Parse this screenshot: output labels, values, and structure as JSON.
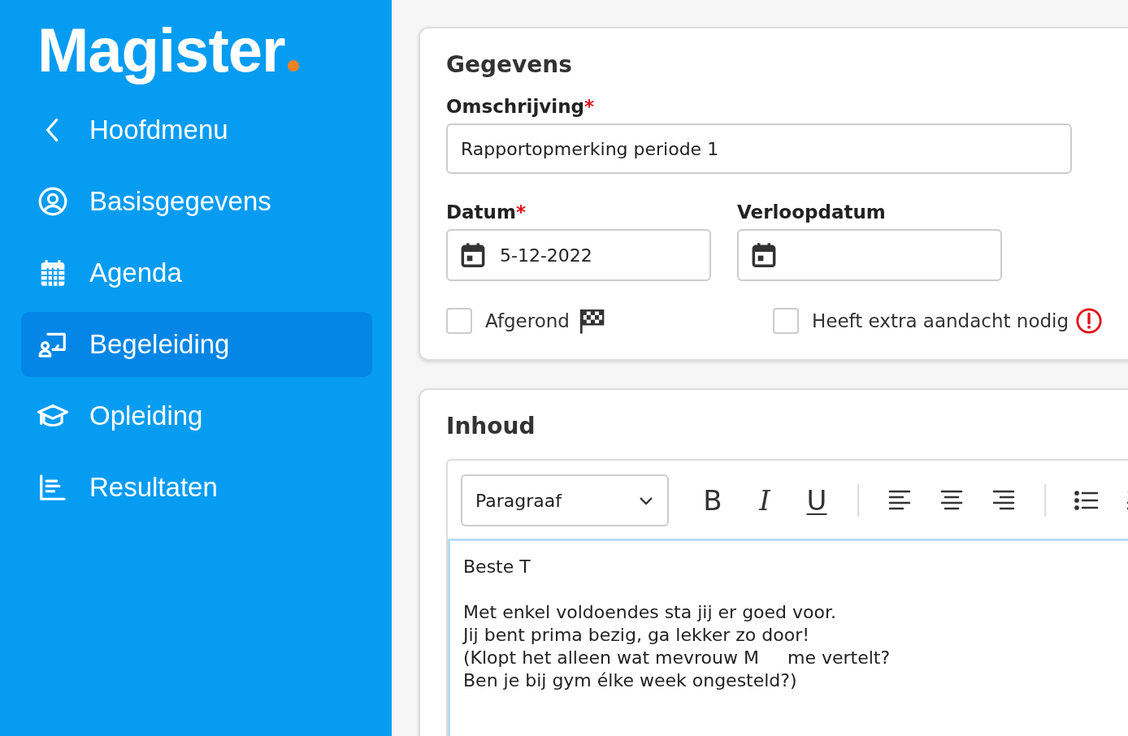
{
  "sidebar": {
    "logo": "Magister",
    "items": [
      {
        "label": "Hoofdmenu",
        "kind": "back",
        "selected": false
      },
      {
        "label": "Basisgegevens",
        "kind": "person",
        "selected": false
      },
      {
        "label": "Agenda",
        "kind": "calendar",
        "selected": false
      },
      {
        "label": "Begeleiding",
        "kind": "guidance",
        "selected": true
      },
      {
        "label": "Opleiding",
        "kind": "education",
        "selected": false
      },
      {
        "label": "Resultaten",
        "kind": "results",
        "selected": false
      }
    ]
  },
  "gegevens": {
    "title": "Gegevens",
    "omschrijving": {
      "label": "Omschrijving",
      "required_mark": "*",
      "value": "Rapportopmerking periode 1"
    },
    "datum": {
      "label": "Datum",
      "required_mark": "*",
      "value": "5-12-2022"
    },
    "verloopdatum": {
      "label": "Verloopdatum"
    },
    "afgerond": {
      "label": "Afgerond",
      "checked": false
    },
    "aandacht": {
      "label": "Heeft extra aandacht nodig",
      "checked": false
    }
  },
  "inhoud": {
    "title": "Inhoud",
    "toolbar": {
      "format": "Paragraaf",
      "buttons": [
        {
          "kind": "bold",
          "label": "B"
        },
        {
          "kind": "italic",
          "label": "I"
        },
        {
          "kind": "underline",
          "label": "U"
        }
      ]
    },
    "body": [
      {
        "lines": [
          "Beste T"
        ]
      },
      {
        "lines": [
          "Met enkel voldoendes sta jij er goed voor.",
          "Jij bent prima bezig, ga lekker zo door!",
          "(Klopt het alleen wat mevrouw M     me vertelt?",
          "Ben je bij gym élke week ongesteld?)"
        ]
      }
    ]
  }
}
